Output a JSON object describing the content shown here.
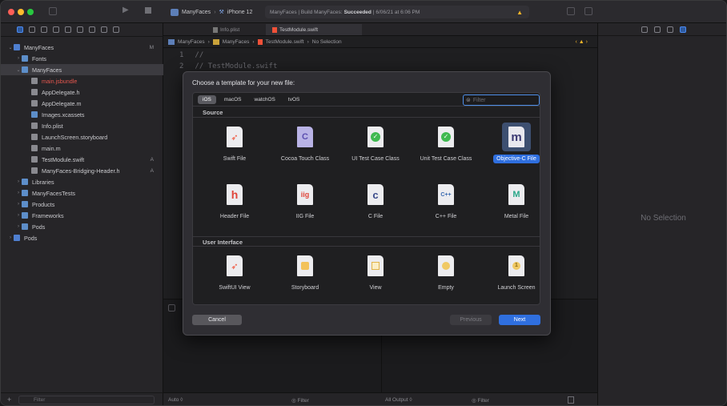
{
  "toolbar": {
    "scheme": "ManyFaces",
    "destination": "iPhone 12",
    "status_prefix": "ManyFaces | Build ManyFaces:",
    "status_result": "Succeeded",
    "status_time": "| 6/06/21 at 6:06 PM"
  },
  "navigator": {
    "items": [
      {
        "label": "ManyFaces",
        "badge": "M",
        "disc": "⌄",
        "kind": "proj"
      },
      {
        "label": "Fonts",
        "badge": "",
        "disc": "›",
        "kind": "fold"
      },
      {
        "label": "ManyFaces",
        "badge": "",
        "disc": "⌄",
        "kind": "fold"
      },
      {
        "label": "main.jsbundle",
        "badge": "",
        "disc": "",
        "kind": "file-red"
      },
      {
        "label": "AppDelegate.h",
        "badge": "",
        "disc": "",
        "kind": "file"
      },
      {
        "label": "AppDelegate.m",
        "badge": "",
        "disc": "",
        "kind": "file"
      },
      {
        "label": "Images.xcassets",
        "badge": "",
        "disc": "",
        "kind": "fold"
      },
      {
        "label": "Info.plist",
        "badge": "",
        "disc": "",
        "kind": "file"
      },
      {
        "label": "LaunchScreen.storyboard",
        "badge": "",
        "disc": "",
        "kind": "file"
      },
      {
        "label": "main.m",
        "badge": "",
        "disc": "",
        "kind": "file"
      },
      {
        "label": "TestModule.swift",
        "badge": "A",
        "disc": "",
        "kind": "file"
      },
      {
        "label": "ManyFaces-Bridging-Header.h",
        "badge": "A",
        "disc": "",
        "kind": "file"
      },
      {
        "label": "Libraries",
        "badge": "",
        "disc": "›",
        "kind": "fold"
      },
      {
        "label": "ManyFacesTests",
        "badge": "",
        "disc": "›",
        "kind": "fold"
      },
      {
        "label": "Products",
        "badge": "",
        "disc": "›",
        "kind": "fold"
      },
      {
        "label": "Frameworks",
        "badge": "",
        "disc": "›",
        "kind": "fold"
      },
      {
        "label": "Pods",
        "badge": "",
        "disc": "›",
        "kind": "fold"
      },
      {
        "label": "Pods",
        "badge": "",
        "disc": "›",
        "kind": "proj"
      }
    ],
    "filter_placeholder": "Filter"
  },
  "editor": {
    "tab_inactive": "Info.plist",
    "tab_active": "TestModule.swift",
    "jump_bar": [
      "ManyFaces",
      "ManyFaces",
      "TestModule.swift",
      "No Selection"
    ],
    "code_lines": [
      {
        "num": "1",
        "text": "//"
      },
      {
        "num": "2",
        "text": "//  TestModule.swift"
      }
    ],
    "bottom_left": "Auto ◊",
    "bottom_filter": "Filter",
    "bottom_output": "All Output ◊",
    "bottom_filter2": "Filter"
  },
  "inspector": {
    "no_selection": "No Selection"
  },
  "dialog": {
    "title": "Choose a template for your new file:",
    "platforms": [
      "iOS",
      "macOS",
      "watchOS",
      "tvOS"
    ],
    "selected_platform": "iOS",
    "filter_placeholder": "Filter",
    "source_header": "Source",
    "source_templates": [
      {
        "label": "Swift File",
        "glyph": "swift"
      },
      {
        "label": "Cocoa Touch Class",
        "glyph": "C"
      },
      {
        "label": "UI Test Case Class",
        "glyph": "✓"
      },
      {
        "label": "Unit Test Case Class",
        "glyph": "✓"
      },
      {
        "label": "Objective-C File",
        "glyph": "m"
      },
      {
        "label": "Header File",
        "glyph": "h"
      },
      {
        "label": "IIG File",
        "glyph": "iig"
      },
      {
        "label": "C File",
        "glyph": "c"
      },
      {
        "label": "C++ File",
        "glyph": "C++"
      },
      {
        "label": "Metal File",
        "glyph": "M"
      }
    ],
    "ui_header": "User Interface",
    "ui_templates": [
      {
        "label": "SwiftUI View",
        "glyph": "swift"
      },
      {
        "label": "Storyboard",
        "glyph": "sb"
      },
      {
        "label": "View",
        "glyph": "v"
      },
      {
        "label": "Empty",
        "glyph": "e"
      },
      {
        "label": "Launch Screen",
        "glyph": "1"
      }
    ],
    "cancel": "Cancel",
    "previous": "Previous",
    "next": "Next"
  },
  "colors": {
    "accent": "#2f6fdf",
    "swift": "#f05138",
    "header_h": "#e0453a",
    "test_green": "#3fb950",
    "objc": "#3c3a73",
    "warning": "#f0b429"
  }
}
